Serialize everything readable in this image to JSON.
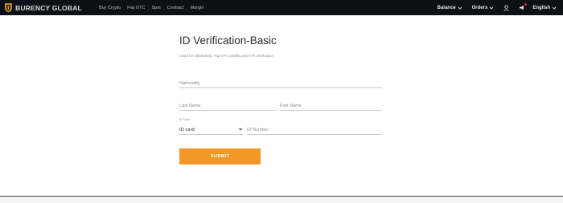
{
  "header": {
    "brand": "BURENCY GLOBAL",
    "nav": [
      "Buy Crypto",
      "Fiat OTC",
      "Spot",
      "Contract",
      "Margin"
    ],
    "balance_label": "Balance",
    "orders_label": "Orders",
    "language_label": "English",
    "colors": {
      "bar": "#0d1016",
      "logo_gold": "#c98a2a"
    }
  },
  "form": {
    "title": "ID Verification-Basic",
    "subtitle": "Used for withdrawal, Fiat OTC trading and API verification",
    "nationality_placeholder": "Nationality",
    "last_name_placeholder": "Last Name",
    "first_name_placeholder": "First Name",
    "id_type_label": "ID Type",
    "id_type_value": "ID card",
    "id_number_placeholder": "ID Number",
    "submit_label": "SUBMIT",
    "accent": "#f29826"
  }
}
